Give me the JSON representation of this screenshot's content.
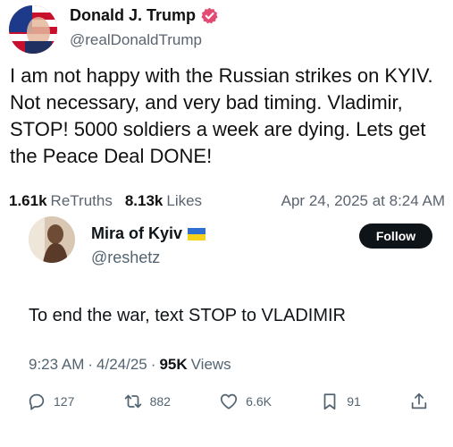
{
  "truth_post": {
    "author_name": "Donald J. Trump",
    "author_handle": "@realDonaldTrump",
    "body": "I am not happy with the Russian strikes on KYIV. Not necessary, and very bad timing. Vladimir, STOP! 5000 soldiers a week are dying. Lets get the Peace Deal DONE!",
    "retruths_count": "1.61k",
    "retruths_label": "ReTruths",
    "likes_count": "8.13k",
    "likes_label": "Likes",
    "timestamp": "Apr 24, 2025 at 8:24 AM",
    "verified_color": "#e24c73"
  },
  "x_post": {
    "author_name": "Mira of Kyiv",
    "author_handle": "@reshetz",
    "follow_label": "Follow",
    "body": "To end the war, text STOP to VLADIMIR",
    "time": "9:23 AM",
    "separator": "·",
    "date": "4/24/25",
    "views_count": "95K",
    "views_label": "Views",
    "actions": {
      "replies": "127",
      "reposts": "882",
      "likes": "6.6K",
      "bookmarks": "91"
    },
    "flag_colors": [
      "#2f6fd1",
      "#f7d21c"
    ]
  }
}
